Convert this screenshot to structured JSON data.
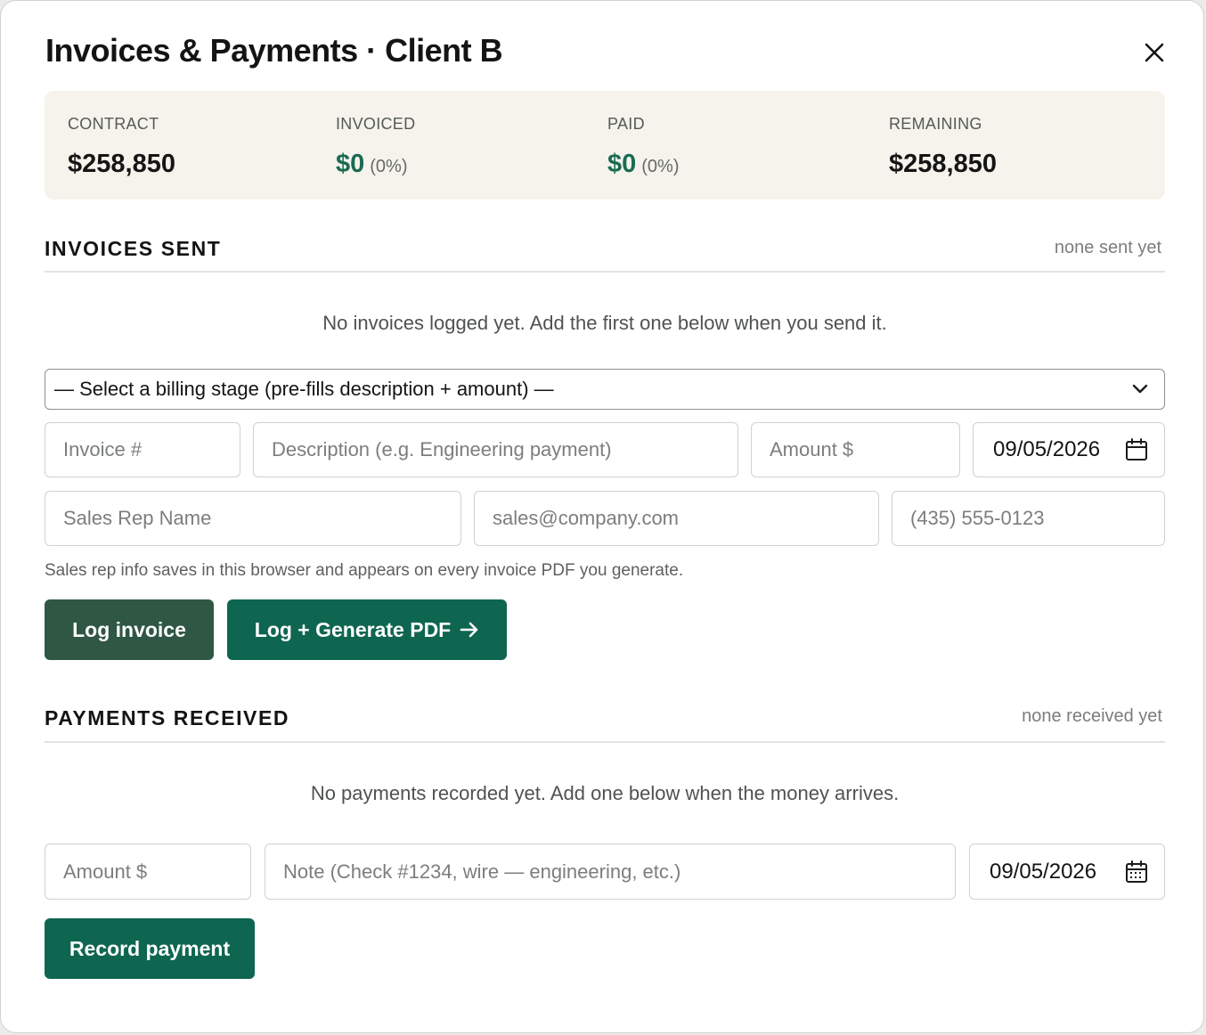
{
  "modal": {
    "title": "Invoices & Payments · Client B"
  },
  "summary": {
    "contract": {
      "label": "CONTRACT",
      "value": "$258,850"
    },
    "invoiced": {
      "label": "INVOICED",
      "value": "$0",
      "pct": "(0%)"
    },
    "paid": {
      "label": "PAID",
      "value": "$0",
      "pct": "(0%)"
    },
    "remaining": {
      "label": "REMAINING",
      "value": "$258,850"
    }
  },
  "invoices": {
    "title": "INVOICES SENT",
    "meta": "none sent yet",
    "empty": "No invoices logged yet. Add the first one below when you send it.",
    "stage_select": "— Select a billing stage (pre-fills description + amount) —",
    "invoice_no_placeholder": "Invoice #",
    "description_placeholder": "Description (e.g. Engineering payment)",
    "amount_placeholder": "Amount $",
    "date": "09/05/2026",
    "rep_name_placeholder": "Sales Rep Name",
    "rep_email_placeholder": "sales@company.com",
    "rep_phone_placeholder": "(435) 555-0123",
    "helper": "Sales rep info saves in this browser and appears on every invoice PDF you generate.",
    "log_button": "Log invoice",
    "log_pdf_button": "Log + Generate PDF"
  },
  "payments": {
    "title": "PAYMENTS RECEIVED",
    "meta": "none received yet",
    "empty": "No payments recorded yet. Add one below when the money arrives.",
    "amount_placeholder": "Amount $",
    "note_placeholder": "Note (Check #1234, wire — engineering, etc.)",
    "date": "09/05/2026",
    "record_button": "Record payment"
  },
  "colors": {
    "accent_green": "#0f6650",
    "dark_green": "#2f5744",
    "summary_bg": "#f5f3ec",
    "money_green": "#1a6b52"
  },
  "icons": {
    "close": "close-icon",
    "chevron": "chevron-down-icon",
    "calendar": "calendar-icon",
    "arrow": "arrow-right-icon"
  }
}
